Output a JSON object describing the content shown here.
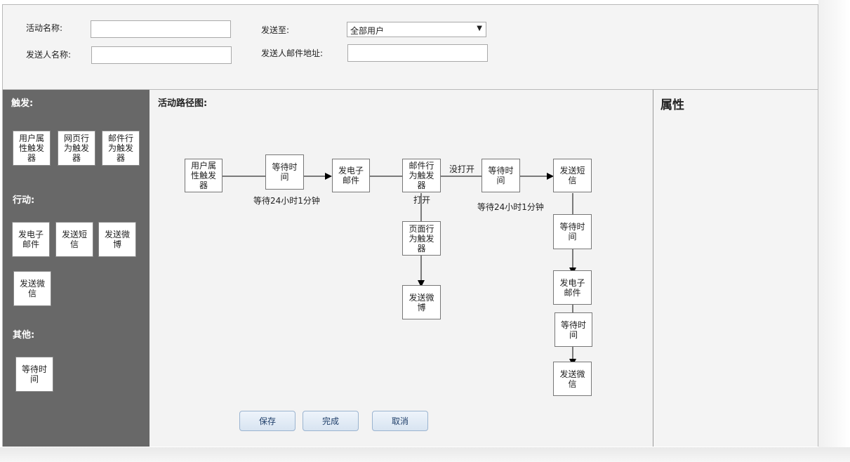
{
  "form": {
    "activity_name_label": "活动名称:",
    "activity_name_value": "",
    "sender_name_label": "发送人名称:",
    "sender_name_value": "",
    "send_to_label": "发送至:",
    "send_to_value": "全部用户",
    "sender_email_label": "发送人邮件地址:",
    "sender_email_value": ""
  },
  "palette": {
    "trigger_title": "触发:",
    "triggers": [
      "用户属性触发器",
      "网页行为触发器",
      "邮件行为触发器"
    ],
    "action_title": "行动:",
    "actions": [
      "发电子邮件",
      "发送短信",
      "发送微博",
      "发送微信"
    ],
    "other_title": "其他:",
    "others": [
      "等待时间"
    ]
  },
  "canvas": {
    "title": "活动路径图:",
    "nodes": {
      "user_attr_trigger": "用户属性触发器",
      "wait1": "等待时间",
      "send_email1": "发电子邮件",
      "email_trigger": "邮件行为触发器",
      "wait2": "等待时间",
      "send_sms": "发送短信",
      "page_trigger": "页面行为触发器",
      "send_weibo": "发送微博",
      "wait3": "等待时间",
      "send_email2": "发电子邮件",
      "wait4": "等待时间",
      "send_wechat": "发送微信"
    },
    "labels": {
      "wait1_label": "等待24小时1分钟",
      "not_opened": "没打开",
      "opened": "打开",
      "wait2_label": "等待24小时1分钟"
    }
  },
  "buttons": {
    "save": "保存",
    "finish": "完成",
    "cancel": "取消"
  },
  "properties": {
    "title": "属性"
  }
}
